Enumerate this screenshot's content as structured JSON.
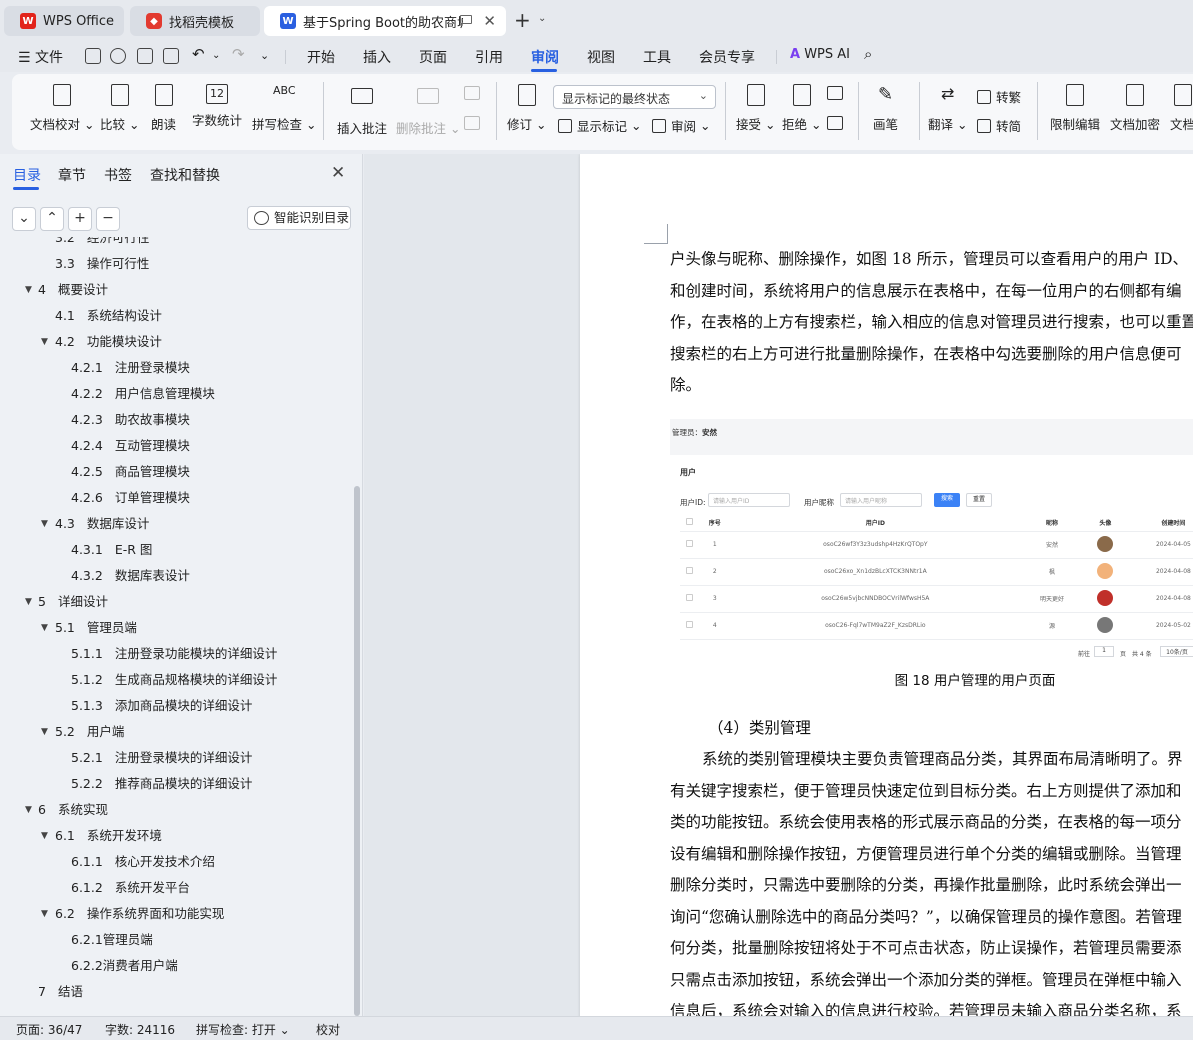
{
  "tabs": [
    {
      "label": "WPS Office"
    },
    {
      "label": "找稻壳模板"
    },
    {
      "label": "基于Spring Boot的助农商城的"
    }
  ],
  "menu": {
    "file": "文件",
    "items": [
      "开始",
      "插入",
      "页面",
      "引用",
      "审阅",
      "视图",
      "工具",
      "会员专享"
    ],
    "wps_ai": "WPS AI"
  },
  "ribbon": {
    "proofread": "文档校对",
    "compare": "比较",
    "read_aloud": "朗读",
    "word_count": "字数统计",
    "word_count_icon": "12",
    "spell_check": "拼写检查",
    "spell_check_icon": "ABC",
    "insert_comment": "插入批注",
    "delete_comment": "删除批注",
    "revise": "修订",
    "markup_state": "显示标记的最终状态",
    "show_markup": "显示标记",
    "review": "审阅",
    "accept": "接受",
    "reject": "拒绝",
    "ink": "画笔",
    "translate": "翻译",
    "to_traditional": "转繁",
    "to_simplified": "转简",
    "restrict_edit": "限制编辑",
    "encrypt": "文档加密",
    "more": "文档"
  },
  "sidebar": {
    "tabs": [
      "目录",
      "章节",
      "书签",
      "查找和替换"
    ],
    "ai_toc": "智能识别目录",
    "toc": [
      {
        "num": "3.2",
        "title": "经济可行性",
        "level": 2
      },
      {
        "num": "3.3",
        "title": "操作可行性",
        "level": 2
      },
      {
        "num": "4",
        "title": "概要设计",
        "level": 1,
        "open": true
      },
      {
        "num": "4.1",
        "title": "系统结构设计",
        "level": 2
      },
      {
        "num": "4.2",
        "title": "功能模块设计",
        "level": 2,
        "open": true
      },
      {
        "num": "4.2.1",
        "title": "注册登录模块",
        "level": 3
      },
      {
        "num": "4.2.2",
        "title": "用户信息管理模块",
        "level": 3
      },
      {
        "num": "4.2.3",
        "title": "助农故事模块",
        "level": 3
      },
      {
        "num": "4.2.4",
        "title": "互动管理模块",
        "level": 3
      },
      {
        "num": "4.2.5",
        "title": "商品管理模块",
        "level": 3
      },
      {
        "num": "4.2.6",
        "title": "订单管理模块",
        "level": 3
      },
      {
        "num": "4.3",
        "title": "数据库设计",
        "level": 2,
        "open": true
      },
      {
        "num": "4.3.1",
        "title": "E-R 图",
        "level": 3
      },
      {
        "num": "4.3.2",
        "title": "数据库表设计",
        "level": 3
      },
      {
        "num": "5",
        "title": "详细设计",
        "level": 1,
        "open": true
      },
      {
        "num": "5.1",
        "title": "管理员端",
        "level": 2,
        "open": true
      },
      {
        "num": "5.1.1",
        "title": "注册登录功能模块的详细设计",
        "level": 3
      },
      {
        "num": "5.1.2",
        "title": "生成商品规格模块的详细设计",
        "level": 3
      },
      {
        "num": "5.1.3",
        "title": "添加商品模块的详细设计",
        "level": 3
      },
      {
        "num": "5.2",
        "title": "用户端",
        "level": 2,
        "open": true
      },
      {
        "num": "5.2.1",
        "title": "注册登录模块的详细设计",
        "level": 3
      },
      {
        "num": "5.2.2",
        "title": "推荐商品模块的详细设计",
        "level": 3
      },
      {
        "num": "6",
        "title": "系统实现",
        "level": 1,
        "open": true
      },
      {
        "num": "6.1",
        "title": "系统开发环境",
        "level": 2,
        "open": true
      },
      {
        "num": "6.1.1",
        "title": "核心开发技术介绍",
        "level": 3
      },
      {
        "num": "6.1.2",
        "title": "系统开发平台",
        "level": 3
      },
      {
        "num": "6.2",
        "title": "操作系统界面和功能实现",
        "level": 2,
        "open": true
      },
      {
        "num": "6.2.1管理员端",
        "title": "",
        "level": 3
      },
      {
        "num": "6.2.2消费者用户端",
        "title": "",
        "level": 3
      },
      {
        "num": "7",
        "title": "结语",
        "level": 1
      }
    ]
  },
  "document": {
    "para1": [
      "户头像与昵称、删除操作，如图 18 所示，管理员可以查看用户的用户 ID、",
      "和创建时间，系统将用户的信息展示在表格中，在每一位用户的右侧都有编",
      "作，在表格的上方有搜索栏，输入相应的信息对管理员进行搜索，也可以重置",
      "搜索栏的右上方可进行批量删除操作，在表格中勾选要删除的用户信息便可",
      "除。"
    ],
    "figure": {
      "admin_label": "管理员：",
      "admin_name": "安然",
      "card_title": "用户",
      "id_label": "用户ID:",
      "id_placeholder": "请输入用户ID",
      "nick_label": "用户昵称",
      "nick_placeholder": "请输入用户昵称",
      "search_btn": "搜索",
      "reset_btn": "重置",
      "columns": [
        "序号",
        "用户ID",
        "昵称",
        "头像",
        "创建时间"
      ],
      "rows": [
        {
          "no": "1",
          "uid": "osoC26wf3Y3z3udshp4HzKrQTOpY",
          "nick": "安然",
          "date": "2024-04-05",
          "avatar": "#8a6a4a"
        },
        {
          "no": "2",
          "uid": "osoC26xo_Xn1dzBLcXTCK3NNtr1A",
          "nick": "枫",
          "date": "2024-04-08",
          "avatar": "#f2b27a"
        },
        {
          "no": "3",
          "uid": "osoC26w5vjbcNNDBOCVrilWfwsH5A",
          "nick": "明天更好",
          "date": "2024-04-08",
          "avatar": "#c0302a"
        },
        {
          "no": "4",
          "uid": "osoC26-Fql7wTM9aZ2F_KzsDRLio",
          "nick": "源",
          "date": "2024-05-02",
          "avatar": "#777777"
        }
      ],
      "pager_prefix": "前往",
      "pager_page": "1",
      "pager_unit": "页",
      "pager_total": "共 4 条",
      "pager_size": "10条/页"
    },
    "caption": "图 18  用户管理的用户页面",
    "heading": "（4）类别管理",
    "para2": [
      "系统的类别管理模块主要负责管理商品分类，其界面布局清晰明了。界",
      "有关键字搜索栏，便于管理员快速定位到目标分类。右上方则提供了添加和",
      "类的功能按钮。系统会使用表格的形式展示商品的分类，在表格的每一项分",
      "设有编辑和删除操作按钮，方便管理员进行单个分类的编辑或删除。当管理",
      "删除分类时，只需选中要删除的分类，再操作批量删除，此时系统会弹出一",
      "询问“您确认删除选中的商品分类吗？”，以确保管理员的操作意图。若管理",
      "何分类，批量删除按钮将处于不可点击状态，防止误操作，若管理员需要添",
      "只需点击添加按钮，系统会弹出一个添加分类的弹框。管理员在弹框中输入",
      "信息后，系统会对输入的信息进行校验。若管理员未输入商品分类名称，系"
    ]
  },
  "status": {
    "page": "页面: 36/47",
    "words": "字数: 24116",
    "spell": "拼写检查: 打开",
    "proof": "校对"
  },
  "colors": {
    "accent": "#2860e1",
    "wps_red": "#e2231a"
  }
}
